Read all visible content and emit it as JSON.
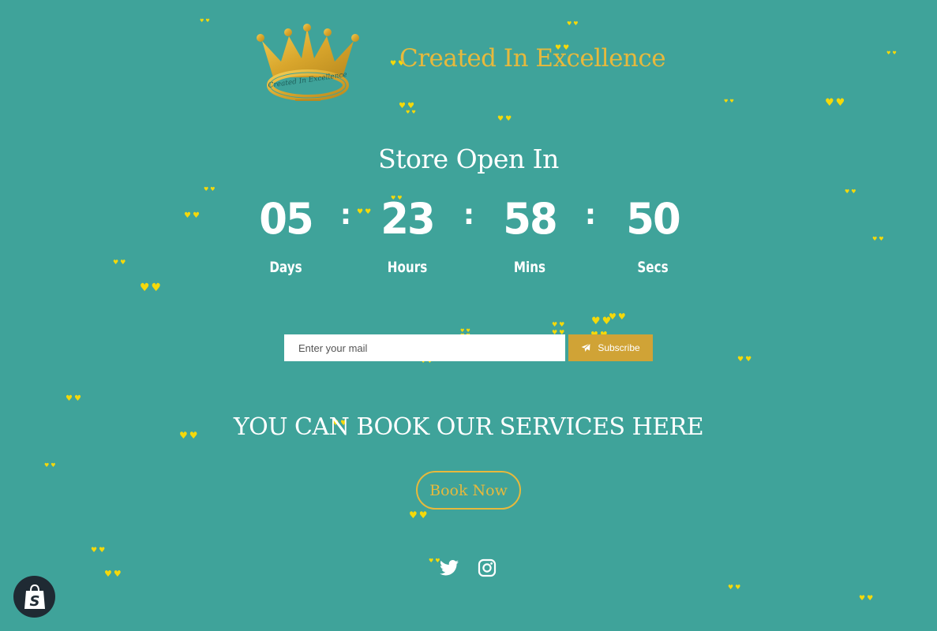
{
  "colors": {
    "background": "#3fa39a",
    "accent_gold": "#e7b93c",
    "subscribe_bg": "#d0a336",
    "heart": "#f5d90a",
    "text": "#ffffff"
  },
  "header": {
    "logo_text": "Created In Excellence",
    "brand_name": "Created In Excellence"
  },
  "countdown": {
    "title": "Store Open In",
    "separator": ":",
    "days": {
      "value": "05",
      "label": "Days"
    },
    "hours": {
      "value": "23",
      "label": "Hours"
    },
    "mins": {
      "value": "58",
      "label": "Mins"
    },
    "secs": {
      "value": "50",
      "label": "Secs"
    }
  },
  "newsletter": {
    "placeholder": "Enter your mail",
    "button_label": "Subscribe",
    "button_icon": "paper-plane-icon"
  },
  "services": {
    "heading": "YOU CAN BOOK OUR SERVICES HERE",
    "button_label": "Book Now"
  },
  "social": {
    "icons": [
      "twitter-icon",
      "instagram-icon"
    ]
  },
  "badge": {
    "icon": "shopify-bag-icon"
  },
  "decoration": {
    "heart_glyph": "♥♥"
  }
}
